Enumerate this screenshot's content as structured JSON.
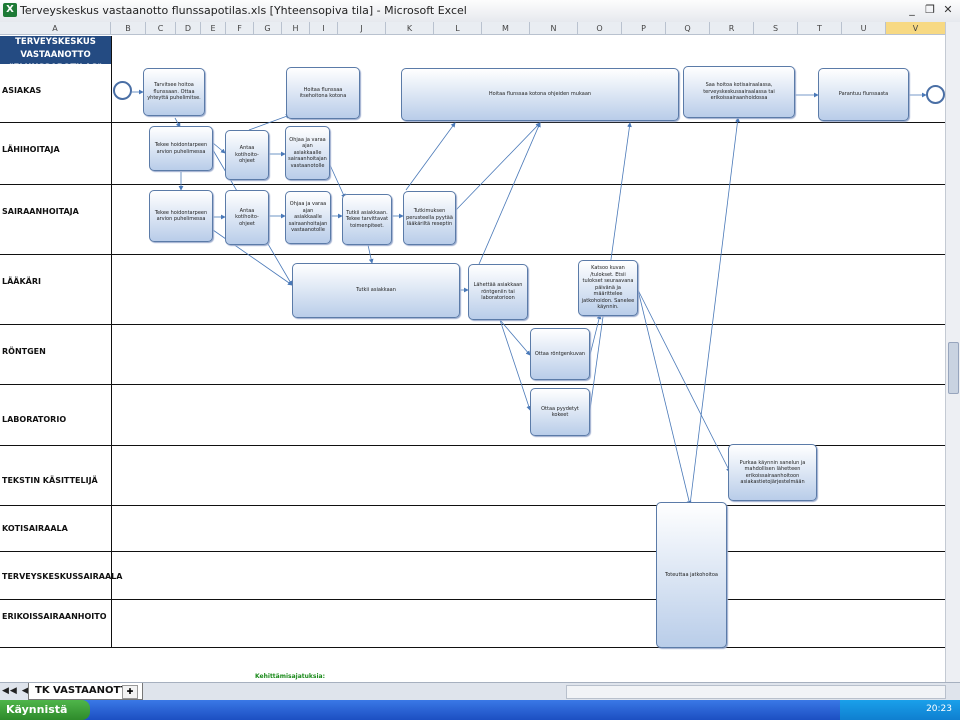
{
  "window": {
    "title": "Terveyskeskus vastaanotto flunssapotilas.xls  [Yhteensopiva tila] - Microsoft Excel",
    "controls": [
      "_",
      "❐",
      "✕"
    ]
  },
  "columns": [
    "A",
    "B",
    "C",
    "D",
    "E",
    "F",
    "G",
    "H",
    "I",
    "J",
    "K",
    "L",
    "M",
    "N",
    "O",
    "P",
    "Q",
    "R",
    "S",
    "T",
    "U",
    "V"
  ],
  "sheet_title": "TERVEYSKESKUS VASTAANOTTO \"FLUNSSAPOTILAS\"",
  "lanes": [
    "ASIAKAS",
    "LÄÄKÄRI",
    "LÄHIHOITAJA",
    "SAIRAANHOITAJA",
    "RÖNTGEN",
    "LABORATORIO",
    "TEKSTIN KÄSITTELIJÄ",
    "KOTISAIRAALA",
    "TERVEYSKESKUSSAIRAALA",
    "ERIKOISSAIRAANHOITO"
  ],
  "boxes": {
    "a1": "Tarvitsee hoitoa flunssaan. Ottaa yhteyttä puhelimitse.",
    "a2": "Hoitaa flunssaa itsehoitona kotona",
    "a3": "Hoitaa flunssaa kotona ohjeiden mukaan",
    "a4": "Saa hoitoa kotisairaalassa, terveyskeskussairaalassa tai erikoissairaanhoidossa",
    "a5": "Parantuu flunssasta",
    "l1": "Tekee hoidontarpeen arvion puhelimessa",
    "l2": "Antaa kotihoito-ohjeet",
    "l3": "Ohjaa ja varaa ajan asiakkaalle sairaanhoitajan vastaanotolle",
    "s1": "Tekee hoidontarpeen arvion puhelimessa",
    "s2": "Antaa kotihoito-ohjeet",
    "s3": "Ohjaa ja varaa ajan asiakkaalle sairaanhoitajan vastaanotolle",
    "s4": "Tutkii asiakkaan. Tekee tarvittavat toimenpiteet.",
    "s5": "Tutkimuksen perusteella pyytää lääkäriltä reseptin",
    "d1": "Tutkii asiakkaan",
    "d2": "Lähettää asiakkaan röntgeniin tai laboratorioon",
    "d3": "Katsoo kuvan /tulokset. Etsii tulokset seuraavana päivänä ja määrittelee jatkohoidon. Sanelee käynnin.",
    "r1": "Ottaa röntgenkuvan",
    "lab1": "Ottaa pyydetyt kokeet",
    "t1": "Purkaa käynnin sanelun ja mahdollisen lähetteen erikoissairaanhoitoon asiakastietojärjestelmään",
    "k1": "Toteuttaa jatkohoitoa"
  },
  "development_note": "Kehittämisajatuksia:",
  "sheet_tab": "TK VASTAANOTTO",
  "nav_arrows": "◀◀ ◀ ▶ ▶▶",
  "taskbar": {
    "start": "Käynnistä",
    "clock": "20:23"
  },
  "accent_colors": {
    "lane_title_bg": "#244b82",
    "box_fill": "#b9cde9",
    "arrow": "#4a79b8",
    "start_green": "#2e8b2b"
  }
}
